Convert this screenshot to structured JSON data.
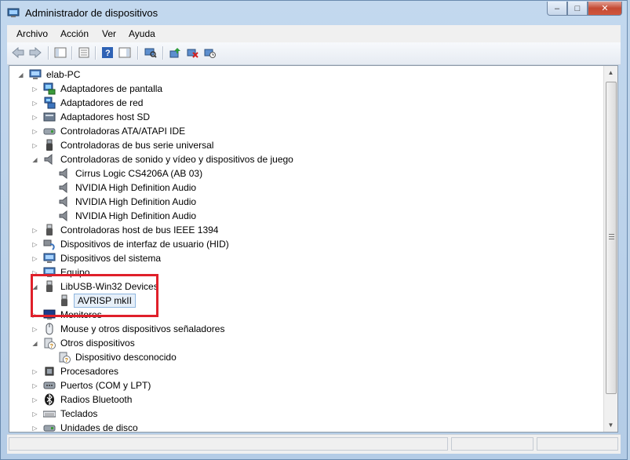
{
  "window": {
    "title": "Administrador de dispositivos",
    "caption": {
      "minimize": "–",
      "maximize": "□",
      "close": "✕"
    }
  },
  "menu": [
    "Archivo",
    "Acción",
    "Ver",
    "Ayuda"
  ],
  "toolbar": [
    "back-icon",
    "forward-icon",
    "console-tree-icon",
    "properties-icon",
    "help-icon",
    "action-pane-icon",
    "scan-hardware-icon",
    "update-driver-icon",
    "disable-device-icon",
    "uninstall-device-icon"
  ],
  "tree": {
    "root": "elab-PC",
    "items": [
      {
        "label": "Adaptadores de pantalla",
        "icon": "display-adapter-icon",
        "expanded": false
      },
      {
        "label": "Adaptadores de red",
        "icon": "network-adapter-icon",
        "expanded": false
      },
      {
        "label": "Adaptadores host SD",
        "icon": "sd-host-icon",
        "expanded": false
      },
      {
        "label": "Controladoras ATA/ATAPI IDE",
        "icon": "ide-controller-icon",
        "expanded": false
      },
      {
        "label": "Controladoras de bus serie universal",
        "icon": "usb-icon",
        "expanded": false
      },
      {
        "label": "Controladoras de sonido y vídeo y dispositivos de juego",
        "icon": "speaker-icon",
        "expanded": true,
        "children": [
          "Cirrus Logic CS4206A (AB 03)",
          "NVIDIA High Definition Audio",
          "NVIDIA High Definition Audio",
          "NVIDIA High Definition Audio"
        ]
      },
      {
        "label": "Controladoras host de bus IEEE 1394",
        "icon": "ieee1394-icon",
        "expanded": false
      },
      {
        "label": "Dispositivos de interfaz de usuario (HID)",
        "icon": "hid-icon",
        "expanded": false
      },
      {
        "label": "Dispositivos del sistema",
        "icon": "system-device-icon",
        "expanded": false
      },
      {
        "label": "Equipo",
        "icon": "computer-icon",
        "expanded": false
      },
      {
        "label": "LibUSB-Win32 Devices",
        "icon": "usb-plug-icon",
        "expanded": true,
        "children": [
          "AVRISP mkII"
        ]
      },
      {
        "label": "Monitores",
        "icon": "monitor-icon",
        "expanded": false
      },
      {
        "label": "Mouse y otros dispositivos señaladores",
        "icon": "mouse-icon",
        "expanded": false
      },
      {
        "label": "Otros dispositivos",
        "icon": "unknown-device-icon",
        "expanded": true,
        "children": [
          "Dispositivo desconocido"
        ]
      },
      {
        "label": "Procesadores",
        "icon": "processor-icon",
        "expanded": false
      },
      {
        "label": "Puertos (COM y LPT)",
        "icon": "port-icon",
        "expanded": false
      },
      {
        "label": "Radios Bluetooth",
        "icon": "bluetooth-icon",
        "expanded": false
      },
      {
        "label": "Teclados",
        "icon": "keyboard-icon",
        "expanded": false
      },
      {
        "label": "Unidades de disco",
        "icon": "disk-drive-icon",
        "expanded": false
      }
    ]
  },
  "colors": {
    "highlight_box": "#e0202a",
    "selection": "#e6eff9"
  }
}
